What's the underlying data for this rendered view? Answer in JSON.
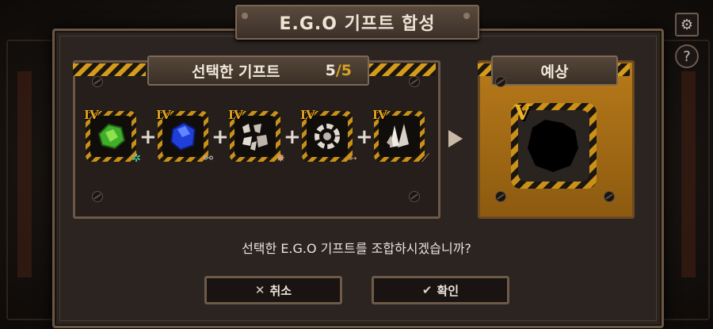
{
  "title": "E.G.O 기프트 합성",
  "selected": {
    "label": "선택한 기프트",
    "count": "5",
    "separator": "/",
    "total": "5",
    "gifts": [
      {
        "tier": "IV",
        "icon": "green-crystal-icon",
        "keyword_icon": "wind-leaf-icon"
      },
      {
        "tier": "IV",
        "icon": "blue-crystal-icon",
        "keyword_icon": "chain-icon"
      },
      {
        "tier": "IV",
        "icon": "shattered-fragments-icon",
        "keyword_icon": "burst-icon"
      },
      {
        "tier": "IV",
        "icon": "broken-gear-icon",
        "keyword_icon": "pierce-icon"
      },
      {
        "tier": "IV",
        "icon": "white-shards-icon",
        "keyword_icon": "slash-icon"
      }
    ],
    "plus": "+"
  },
  "expected": {
    "label": "예상",
    "tier": "V",
    "icon": "unknown-silhouette-icon"
  },
  "question": "선택한 E.G.O 기프트를 조합하시겠습니까?",
  "buttons": {
    "cancel": {
      "icon": "x-icon",
      "glyph": "✕",
      "label": "취소"
    },
    "confirm": {
      "icon": "check-icon",
      "glyph": "✔",
      "label": "확인"
    }
  },
  "top_right": {
    "settings_icon": "gear-icon",
    "help_icon": "question-icon"
  },
  "colors": {
    "accent": "#d9a227",
    "hazard": "#c9901a",
    "expected_panel": "#b87a1a"
  }
}
